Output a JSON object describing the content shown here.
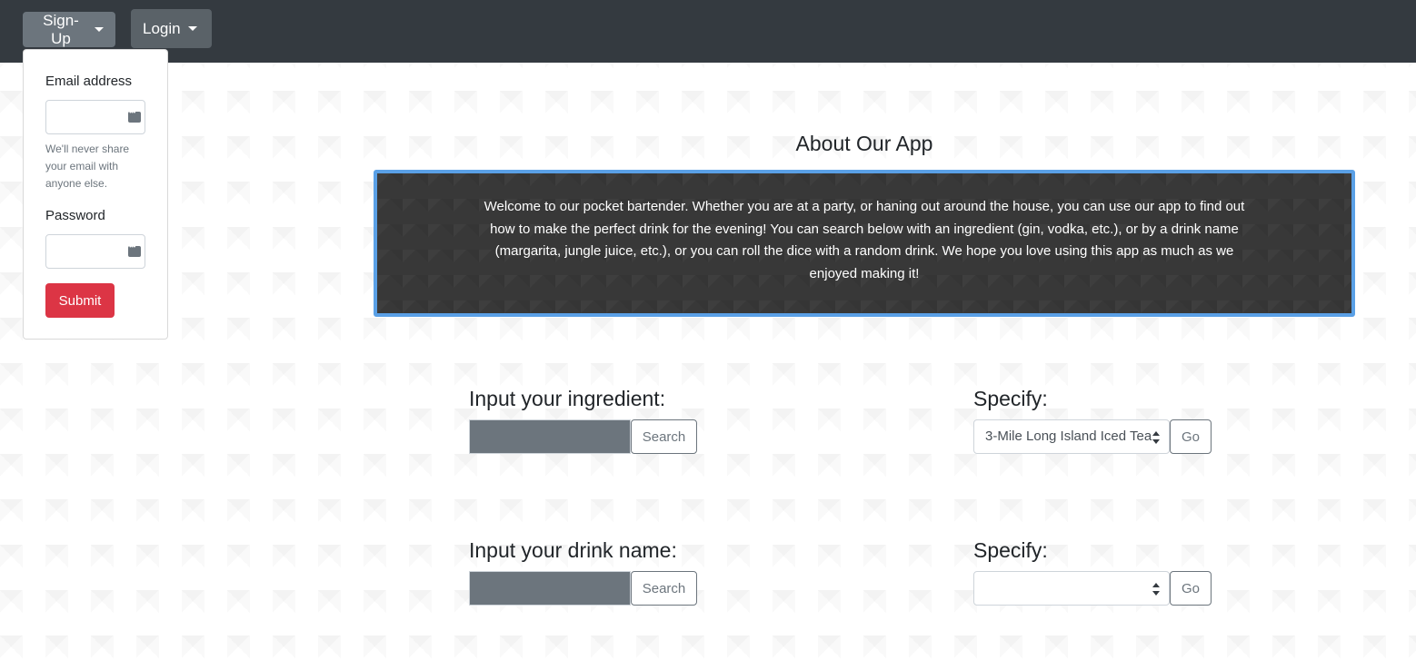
{
  "nav": {
    "signup_label": "Sign-Up",
    "login_label": "Login"
  },
  "signup_form": {
    "email_label": "Email address",
    "email_value": "",
    "email_help": "We'll never share your email with anyone else.",
    "password_label": "Password",
    "password_value": "",
    "submit_label": "Submit"
  },
  "about": {
    "title": "About Our App",
    "text": "Welcome to our pocket bartender. Whether you are at a party, or haning out around the house, you can use our app to find out how to make the perfect drink for the evening! You can search below with an ingredient (gin, vodka, etc.), or by a drink name (margarita, jungle juice, etc.), or you can roll the dice with a random drink. We hope you love using this app as much as we enjoyed making it!"
  },
  "ingredient_search": {
    "label": "Input your ingredient:",
    "input_value": "",
    "search_label": "Search",
    "specify_label": "Specify:",
    "selected": "3-Mile Long Island Iced Tea",
    "go_label": "Go"
  },
  "drink_search": {
    "label": "Input your drink name:",
    "input_value": "",
    "search_label": "Search",
    "specify_label": "Specify:",
    "selected": "",
    "go_label": "Go"
  },
  "colors": {
    "navbar": "#343a40",
    "accent_border": "#5aa0e6",
    "submit": "#dc3545",
    "secondary": "#6c757d"
  }
}
